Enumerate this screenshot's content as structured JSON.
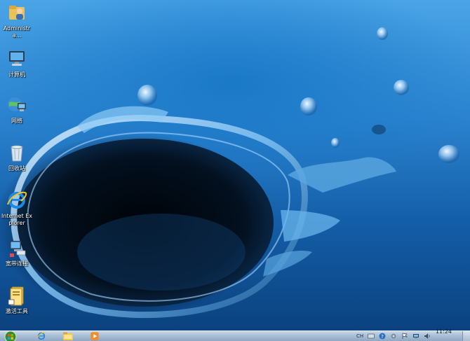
{
  "desktop": {
    "icons": [
      {
        "label": "Administra...",
        "icon": "user-folder-icon"
      },
      {
        "label": "计算机",
        "icon": "computer-icon"
      },
      {
        "label": "网络",
        "icon": "network-icon"
      },
      {
        "label": "回收站",
        "icon": "recycle-bin-icon"
      },
      {
        "label": "Internet Explorer",
        "icon": "internet-explorer-icon"
      },
      {
        "label": "宽带连接",
        "icon": "broadband-connection-icon"
      },
      {
        "label": "激活工具",
        "icon": "activation-tool-icon"
      }
    ]
  },
  "taskbar": {
    "pinned": [
      {
        "icon": "internet-explorer-icon"
      },
      {
        "icon": "file-explorer-icon"
      },
      {
        "icon": "media-player-icon"
      }
    ],
    "tray": {
      "language": "CH",
      "clock_time": "11:24"
    },
    "colors": {
      "taskbar_top": "#c9d7e6",
      "taskbar_bottom": "#8ea8c4",
      "start_orb": "#2f8f2f"
    }
  }
}
